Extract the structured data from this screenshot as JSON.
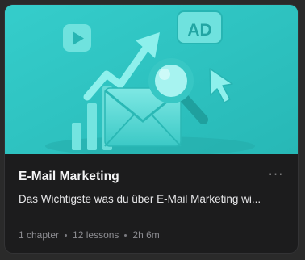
{
  "course_card": {
    "thumbnail": {
      "badge_text": "AD",
      "background_color": "#2fc5c3",
      "icons": [
        "play-icon",
        "ad-badge-icon",
        "rising-arrow-icon",
        "envelope-icon",
        "magnifier-icon",
        "cursor-icon",
        "bar-chart-icon"
      ]
    },
    "title": "E-Mail Marketing",
    "more_label": "···",
    "description": "Das Wichtigste was du über E-Mail Marketing wi...",
    "meta": {
      "chapters": "1 chapter",
      "lessons": "12 lessons",
      "duration": "2h 6m"
    }
  }
}
